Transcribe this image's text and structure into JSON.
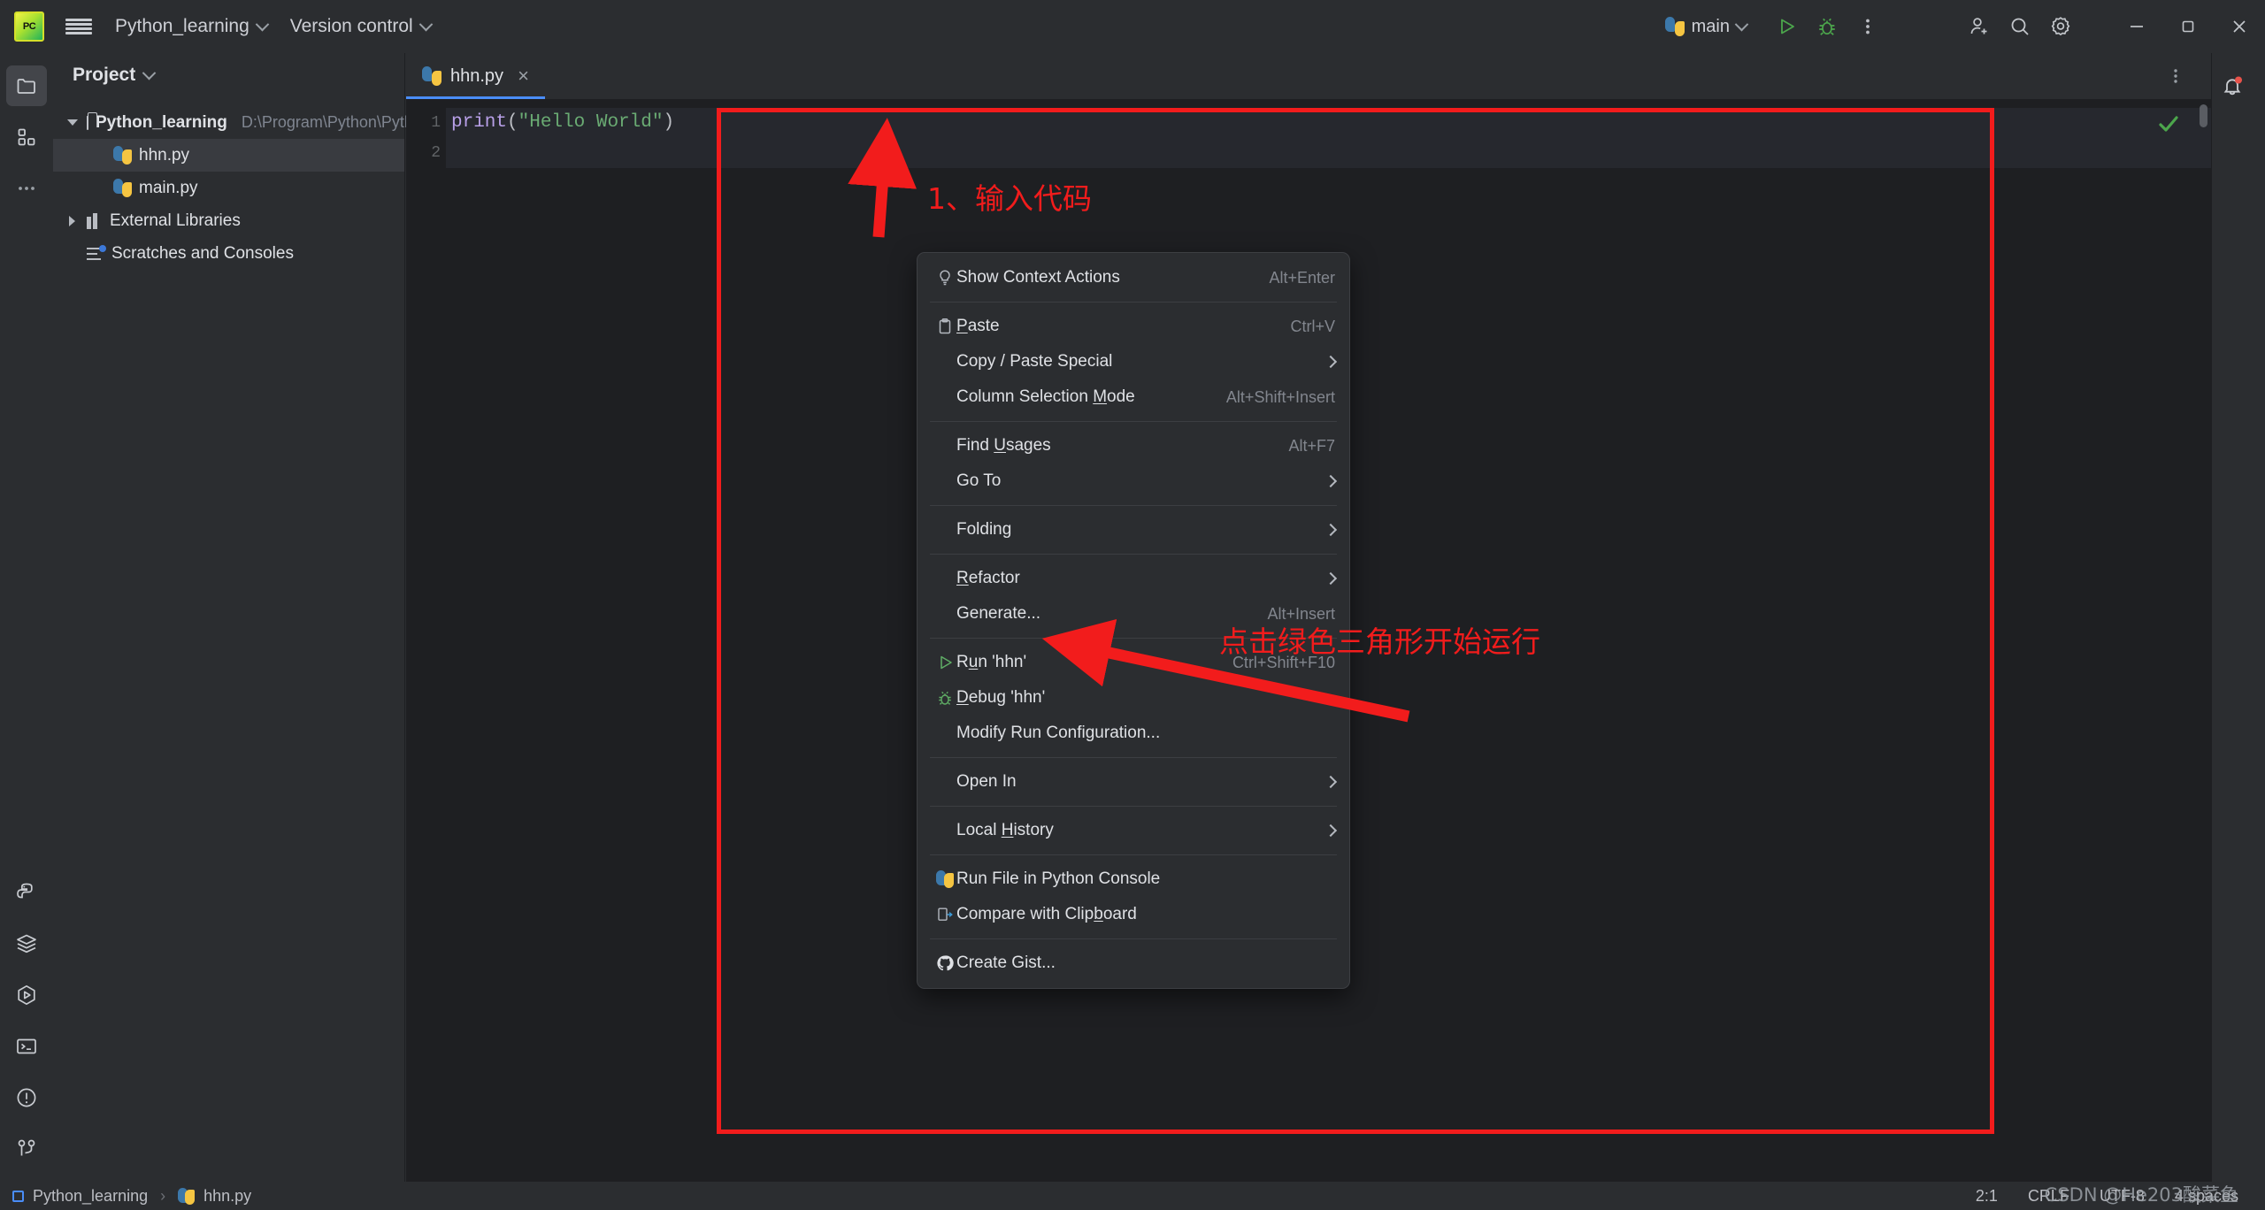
{
  "titlebar": {
    "logo_icon": "pycharm-logo-icon",
    "menu_icon": "hamburger-menu-icon",
    "project_name": "Python_learning",
    "version_control": "Version control",
    "run_config": "main",
    "run_icon": "run-play-icon",
    "debug_icon": "debug-bug-icon",
    "more_icon": "more-vertical-icon",
    "add_user_icon": "add-user-icon",
    "search_icon": "search-icon",
    "settings_icon": "gear-icon",
    "minimize_icon": "minimize-icon",
    "maximize_icon": "maximize-icon",
    "close_icon": "close-icon"
  },
  "rail": {
    "top": [
      {
        "name": "project-folder-icon",
        "active": true
      },
      {
        "name": "structure-icon",
        "active": false
      },
      {
        "name": "more-dots-icon",
        "active": false
      }
    ],
    "bottom": [
      {
        "name": "python-console-icon"
      },
      {
        "name": "database-layers-icon"
      },
      {
        "name": "run-hexagon-icon"
      },
      {
        "name": "terminal-icon"
      },
      {
        "name": "problems-icon"
      },
      {
        "name": "version-control-branch-icon"
      }
    ]
  },
  "project": {
    "title": "Project",
    "tree": [
      {
        "label": "Python_learning",
        "path": "D:\\Program\\Python\\Python_learning",
        "indent": 0,
        "arrow": "down",
        "icon": "folder-icon",
        "bold": true,
        "selected": false
      },
      {
        "label": "hhn.py",
        "path": "",
        "indent": 1,
        "arrow": "none",
        "icon": "python-file-icon",
        "bold": false,
        "selected": true
      },
      {
        "label": "main.py",
        "path": "",
        "indent": 1,
        "arrow": "none",
        "icon": "python-file-icon",
        "bold": false,
        "selected": false
      },
      {
        "label": "External Libraries",
        "path": "",
        "indent": 0,
        "arrow": "right",
        "icon": "library-icon",
        "bold": false,
        "selected": false
      },
      {
        "label": "Scratches and Consoles",
        "path": "",
        "indent": 0,
        "arrow": "none",
        "icon": "scratches-icon",
        "bold": false,
        "selected": false
      }
    ]
  },
  "editor": {
    "tab": {
      "label": "hhn.py",
      "icon": "python-file-icon",
      "close": "×"
    },
    "more_icon": "editor-more-icon",
    "inspection_status_icon": "inspections-ok-check-icon",
    "line_numbers": [
      "1",
      "2"
    ],
    "code": {
      "fn": "print",
      "open_paren": "(",
      "string": "\"Hello World\"",
      "close_paren": ")"
    }
  },
  "right_rail": {
    "notifications_icon": "notification-bell-icon"
  },
  "context_menu": {
    "items": [
      {
        "label": "Show Context Actions",
        "mnemonic": "",
        "key": "Alt+Enter",
        "icon": "lightbulb-icon",
        "submenu": false,
        "sep_after": true
      },
      {
        "label": "Paste",
        "mnemonic": "P",
        "key": "Ctrl+V",
        "icon": "clipboard-icon",
        "submenu": false,
        "sep_after": false
      },
      {
        "label": "Copy / Paste Special",
        "mnemonic": "",
        "key": "",
        "icon": "",
        "submenu": true,
        "sep_after": false
      },
      {
        "label": "Column Selection Mode",
        "mnemonic": "M",
        "key": "Alt+Shift+Insert",
        "icon": "",
        "submenu": false,
        "sep_after": true
      },
      {
        "label": "Find Usages",
        "mnemonic": "U",
        "key": "Alt+F7",
        "icon": "",
        "submenu": false,
        "sep_after": false
      },
      {
        "label": "Go To",
        "mnemonic": "",
        "key": "",
        "icon": "",
        "submenu": true,
        "sep_after": true
      },
      {
        "label": "Folding",
        "mnemonic": "",
        "key": "",
        "icon": "",
        "submenu": true,
        "sep_after": true
      },
      {
        "label": "Refactor",
        "mnemonic": "R",
        "key": "",
        "icon": "",
        "submenu": true,
        "sep_after": false
      },
      {
        "label": "Generate...",
        "mnemonic": "",
        "key": "Alt+Insert",
        "icon": "",
        "submenu": false,
        "sep_after": true
      },
      {
        "label": "Run 'hhn'",
        "mnemonic": "u",
        "key": "Ctrl+Shift+F10",
        "icon": "run-triangle-icon",
        "submenu": false,
        "sep_after": false
      },
      {
        "label": "Debug 'hhn'",
        "mnemonic": "D",
        "key": "",
        "icon": "debug-bug-icon",
        "submenu": false,
        "sep_after": false
      },
      {
        "label": "Modify Run Configuration...",
        "mnemonic": "",
        "key": "",
        "icon": "",
        "submenu": false,
        "sep_after": true
      },
      {
        "label": "Open In",
        "mnemonic": "",
        "key": "",
        "icon": "",
        "submenu": true,
        "sep_after": true
      },
      {
        "label": "Local History",
        "mnemonic": "H",
        "key": "",
        "icon": "",
        "submenu": true,
        "sep_after": true
      },
      {
        "label": "Run File in Python Console",
        "mnemonic": "",
        "key": "",
        "icon": "python-icon",
        "submenu": false,
        "sep_after": false
      },
      {
        "label": "Compare with Clipboard",
        "mnemonic": "b",
        "key": "",
        "icon": "compare-clipboard-icon",
        "submenu": false,
        "sep_after": true
      },
      {
        "label": "Create Gist...",
        "mnemonic": "",
        "key": "",
        "icon": "github-icon",
        "submenu": false,
        "sep_after": false
      }
    ]
  },
  "annotations": {
    "step1": "1、输入代码",
    "step2": "点击绿色三角形开始运行",
    "accent_color": "#f21c1c"
  },
  "statusbar": {
    "breadcrumb": [
      {
        "label": "Python_learning",
        "icon": "module-icon"
      },
      {
        "label": "hhn.py",
        "icon": "python-file-icon"
      }
    ],
    "separator": "›",
    "caret_position": "2:1",
    "line_separator": "CRLF",
    "encoding": "UTF-8",
    "indent": "4 spaces"
  },
  "watermark": "CSDN @He203酸菜鱼"
}
